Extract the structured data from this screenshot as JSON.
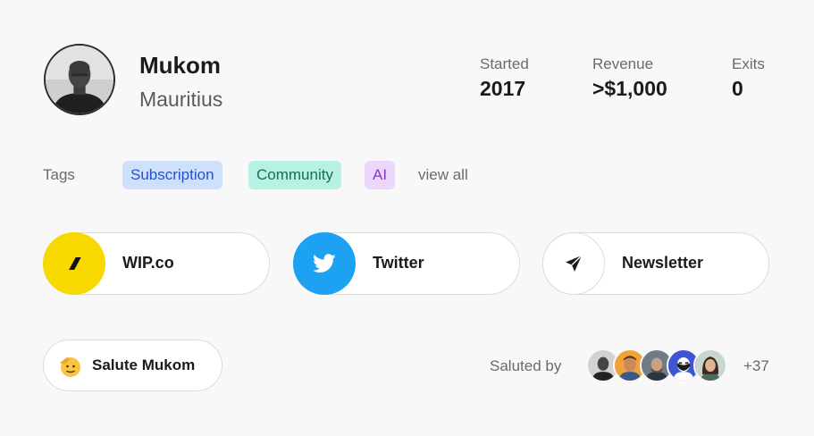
{
  "profile": {
    "name": "Mukom",
    "country": "Mauritius",
    "avatar_icon": "user-photo"
  },
  "stats": [
    {
      "label": "Started",
      "value": "2017"
    },
    {
      "label": "Revenue",
      "value": ">$1,000"
    },
    {
      "label": "Exits",
      "value": "0"
    }
  ],
  "tags": {
    "label": "Tags",
    "items": [
      "Subscription",
      "Community",
      "AI"
    ],
    "view_all": "view all"
  },
  "links": [
    {
      "label": "WIP.co",
      "icon": "wip-logo-icon",
      "color": "#f7d900"
    },
    {
      "label": "Twitter",
      "icon": "twitter-bird-icon",
      "color": "#1da1f2"
    },
    {
      "label": "Newsletter",
      "icon": "paper-plane-icon",
      "color": "#ffffff"
    }
  ],
  "salute": {
    "button_label": "Salute Mukom",
    "emoji_icon": "saluting-face-icon",
    "saluted_by_label": "Saluted by",
    "more_count": "+37"
  }
}
